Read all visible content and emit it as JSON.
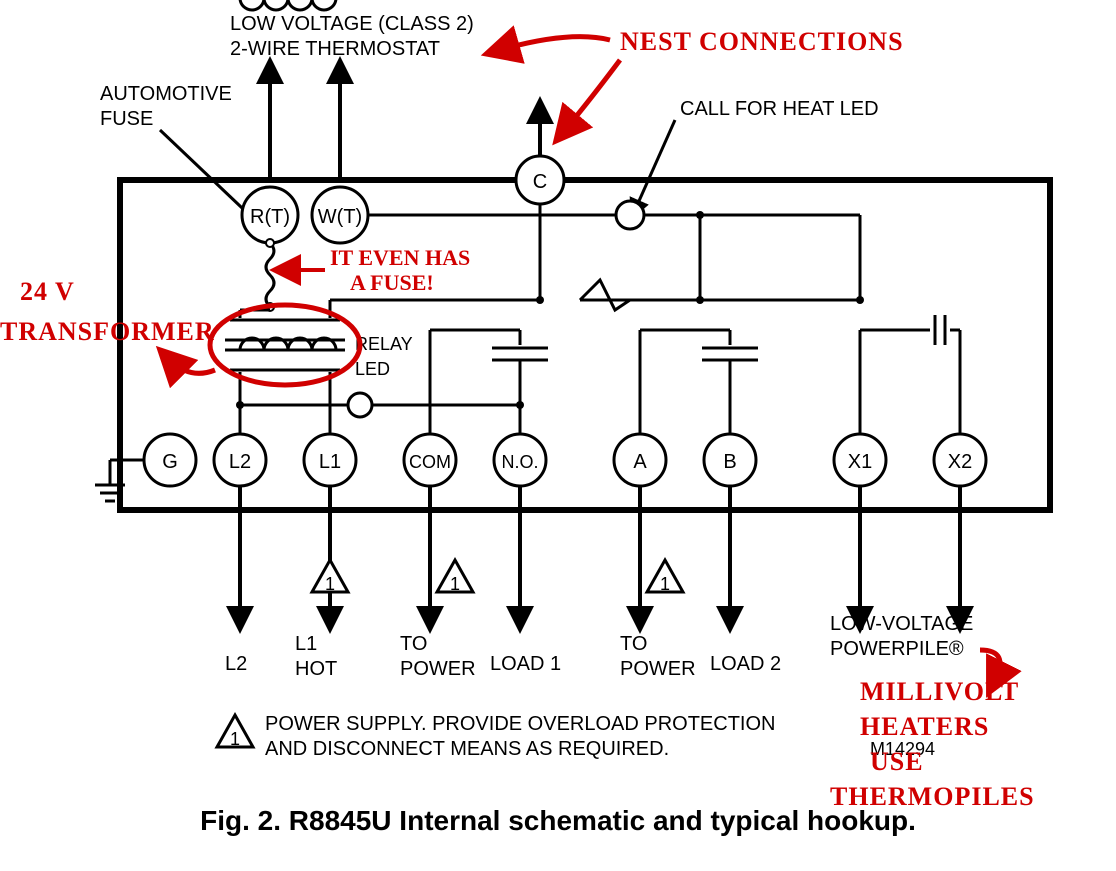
{
  "labels": {
    "thermostat1": "LOW VOLTAGE (CLASS 2)",
    "thermostat2": "2-WIRE THERMOSTAT",
    "autofuse1": "AUTOMOTIVE",
    "autofuse2": "FUSE",
    "callheat": "CALL FOR HEAT LED",
    "relay": "RELAY",
    "led": "LED",
    "l2": "L2",
    "l1hot1": "L1",
    "l1hot2": "HOT",
    "topower": "TO",
    "power": "POWER",
    "load1": "LOAD 1",
    "load2": "LOAD 2",
    "lvpp1": "LOW-VOLTAGE",
    "lvpp2": "POWERPILE®",
    "note": "POWER SUPPLY. PROVIDE OVERLOAD PROTECTION",
    "note2": "AND DISCONNECT MEANS AS REQUIRED.",
    "mnum": "M14294",
    "caption": "Fig. 2. R8845U Internal schematic and typical hookup."
  },
  "terminals": {
    "rt": "R(T)",
    "wt": "W(T)",
    "c": "C",
    "g": "G",
    "tl2": "L2",
    "tl1": "L1",
    "com": "COM",
    "no": "N.O.",
    "a": "A",
    "b": "B",
    "x1": "X1",
    "x2": "X2",
    "tri": "1"
  },
  "annotations": {
    "nest": "NEST CONNECTIONS",
    "fuse": "IT EVEN HAS",
    "fuse2": "A FUSE!",
    "xfmr1": "24 V",
    "xfmr2": "TRANSFORMER",
    "mv1": "MILLIVOLT",
    "mv2": "HEATERS",
    "mv3": "USE",
    "mv4": "THERMOPILES"
  }
}
